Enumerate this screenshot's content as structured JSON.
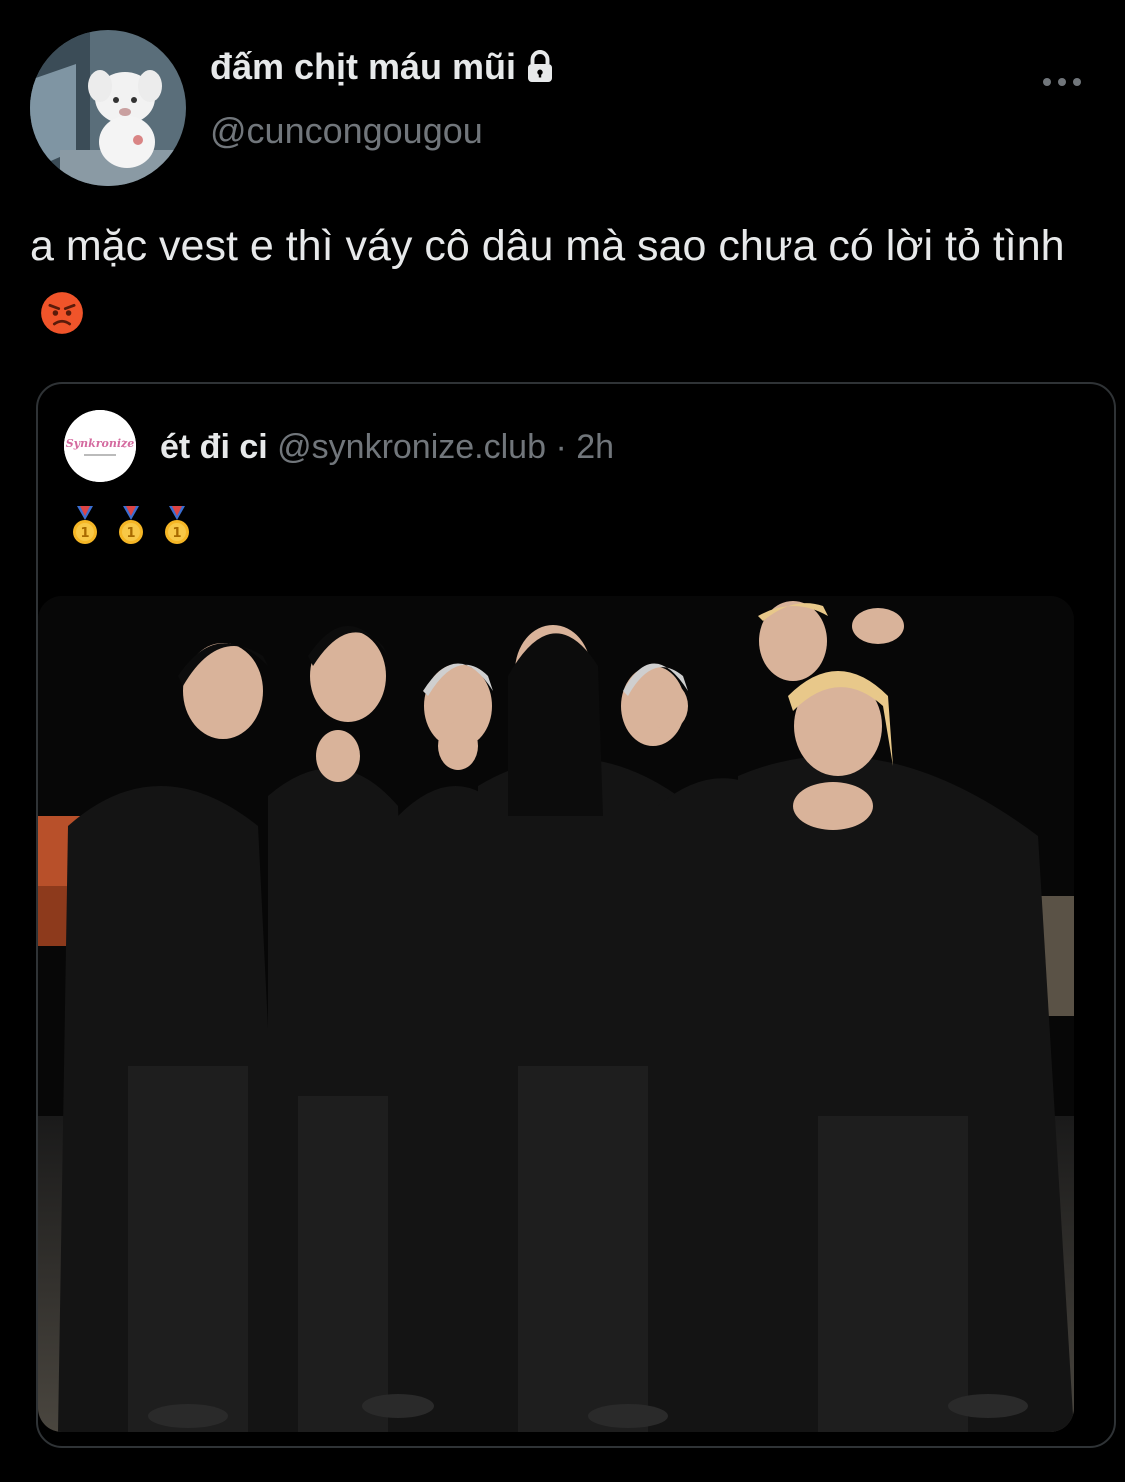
{
  "tweet": {
    "display_name": "đấm chịt máu mũi",
    "handle": "@cuncongougou",
    "text": "a mặc vest e thì váy cô dâu mà sao chưa có lời tỏ tình",
    "protected_icon": "lock-icon",
    "more_icon": "more-horizontal-icon",
    "emoji": "angry-face-emoji"
  },
  "quote": {
    "display_name": "ét đi ci",
    "handle": "@synkronize.club",
    "separator": "·",
    "time": "2h",
    "avatar_logo_text": "Synkronize",
    "medals": [
      "1st-place-medal",
      "1st-place-medal",
      "1st-place-medal"
    ]
  },
  "colors": {
    "background": "#000000",
    "primary_text": "#e7e9ea",
    "secondary_text": "#71767b",
    "border": "#2f3336"
  }
}
